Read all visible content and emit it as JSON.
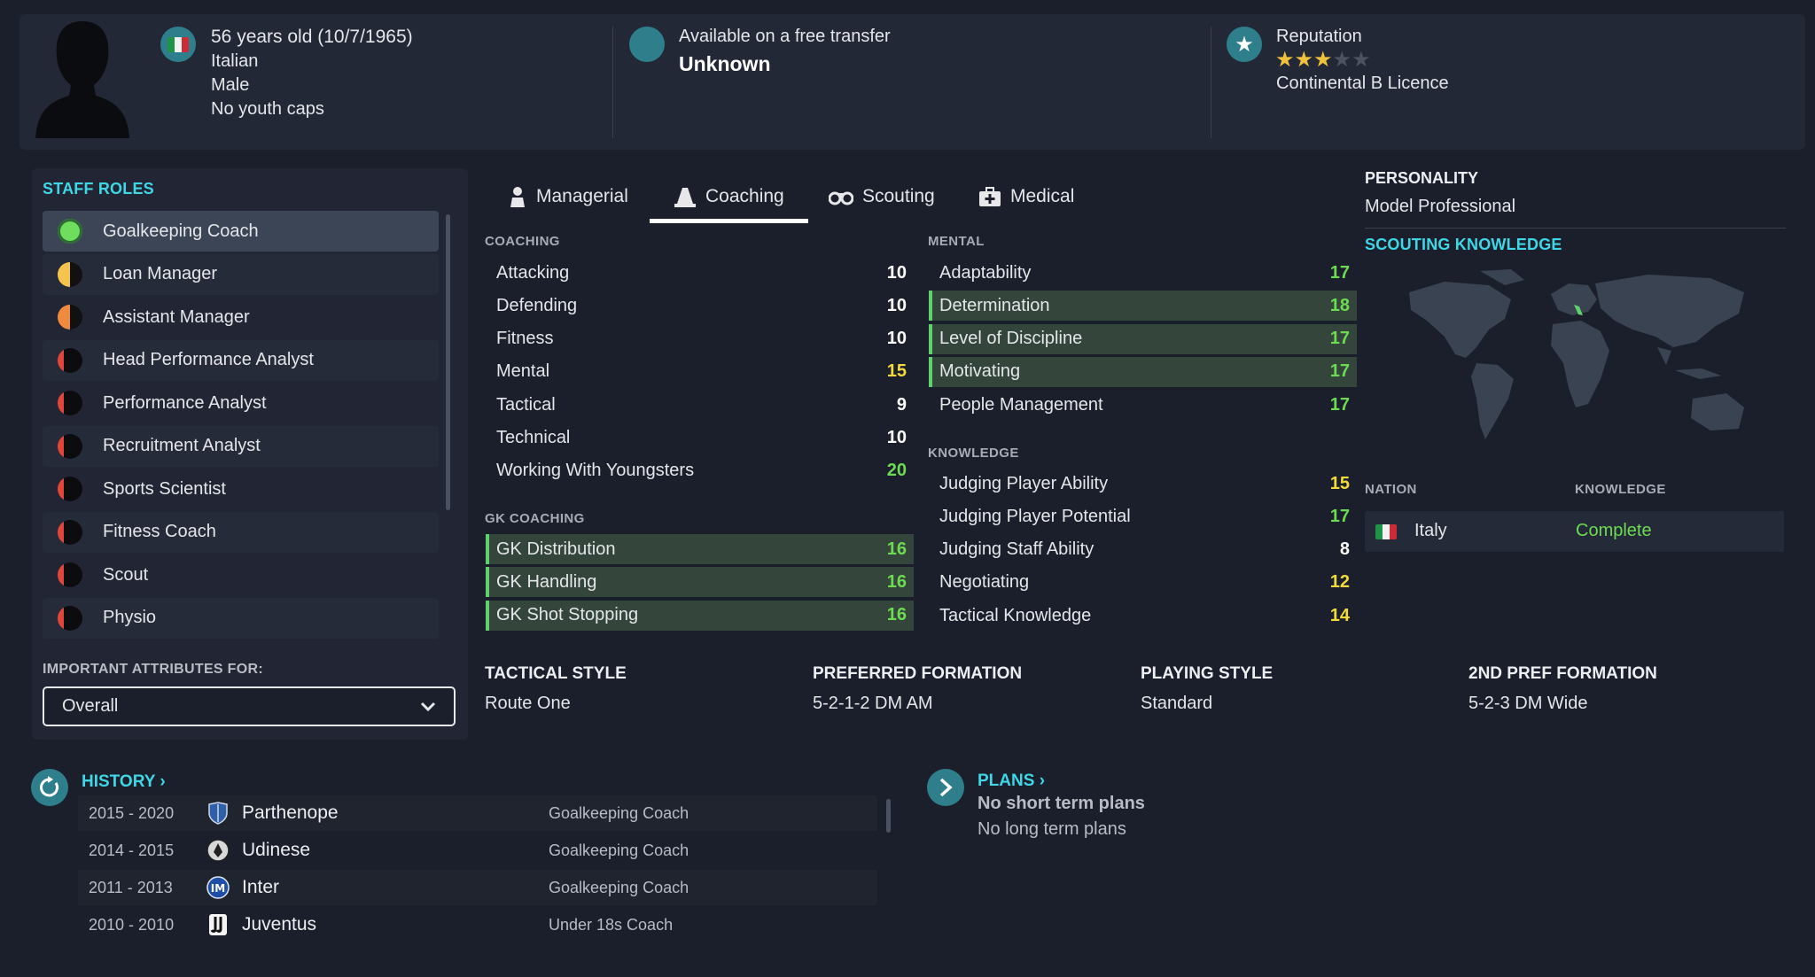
{
  "header": {
    "age_dob": "56 years old (10/7/1965)",
    "nationality": "Italian",
    "gender": "Male",
    "youth_caps": "No youth caps",
    "contract_status": "Available on a free transfer",
    "contract_value": "Unknown",
    "reputation_label": "Reputation",
    "reputation_stars": 3,
    "reputation_max": 5,
    "licence": "Continental B Licence"
  },
  "staff_roles": {
    "title": "STAFF ROLES",
    "items": [
      {
        "label": "Goalkeeping Coach",
        "suitability": "green"
      },
      {
        "label": "Loan Manager",
        "suitability": "half-yellow"
      },
      {
        "label": "Assistant Manager",
        "suitability": "half-orange"
      },
      {
        "label": "Head Performance Analyst",
        "suitability": "red"
      },
      {
        "label": "Performance Analyst",
        "suitability": "red"
      },
      {
        "label": "Recruitment Analyst",
        "suitability": "red"
      },
      {
        "label": "Sports Scientist",
        "suitability": "red"
      },
      {
        "label": "Fitness Coach",
        "suitability": "red"
      },
      {
        "label": "Scout",
        "suitability": "red"
      },
      {
        "label": "Physio",
        "suitability": "red"
      }
    ],
    "important_label": "IMPORTANT ATTRIBUTES FOR:",
    "important_value": "Overall"
  },
  "tabs": [
    {
      "label": "Managerial",
      "icon": "manager-icon"
    },
    {
      "label": "Coaching",
      "icon": "cone-icon",
      "active": true
    },
    {
      "label": "Scouting",
      "icon": "binoculars-icon"
    },
    {
      "label": "Medical",
      "icon": "medical-kit-icon"
    }
  ],
  "coaching": {
    "title": "COACHING",
    "rows": [
      {
        "name": "Attacking",
        "value": "10",
        "color": "white"
      },
      {
        "name": "Defending",
        "value": "10",
        "color": "white"
      },
      {
        "name": "Fitness",
        "value": "10",
        "color": "white"
      },
      {
        "name": "Mental",
        "value": "15",
        "color": "yellow"
      },
      {
        "name": "Tactical",
        "value": "9",
        "color": "white"
      },
      {
        "name": "Technical",
        "value": "10",
        "color": "white"
      },
      {
        "name": "Working With Youngsters",
        "value": "20",
        "color": "green"
      }
    ]
  },
  "gk_coaching": {
    "title": "GK COACHING",
    "rows": [
      {
        "name": "GK Distribution",
        "value": "16",
        "color": "green",
        "highlight": true
      },
      {
        "name": "GK Handling",
        "value": "16",
        "color": "green",
        "highlight": true
      },
      {
        "name": "GK Shot Stopping",
        "value": "16",
        "color": "green",
        "highlight": true
      }
    ]
  },
  "mental": {
    "title": "MENTAL",
    "rows": [
      {
        "name": "Adaptability",
        "value": "17",
        "color": "green"
      },
      {
        "name": "Determination",
        "value": "18",
        "color": "green",
        "highlight": true
      },
      {
        "name": "Level of Discipline",
        "value": "17",
        "color": "green",
        "highlight": true
      },
      {
        "name": "Motivating",
        "value": "17",
        "color": "green",
        "highlight": true
      },
      {
        "name": "People Management",
        "value": "17",
        "color": "green"
      }
    ]
  },
  "knowledge": {
    "title": "KNOWLEDGE",
    "rows": [
      {
        "name": "Judging Player Ability",
        "value": "15",
        "color": "yellow"
      },
      {
        "name": "Judging Player Potential",
        "value": "17",
        "color": "green"
      },
      {
        "name": "Judging Staff Ability",
        "value": "8",
        "color": "white"
      },
      {
        "name": "Negotiating",
        "value": "12",
        "color": "yellow"
      },
      {
        "name": "Tactical Knowledge",
        "value": "14",
        "color": "yellow"
      }
    ]
  },
  "styles": [
    {
      "title": "TACTICAL STYLE",
      "value": "Route One"
    },
    {
      "title": "PREFERRED FORMATION",
      "value": "5-2-1-2 DM AM"
    },
    {
      "title": "PLAYING STYLE",
      "value": "Standard"
    },
    {
      "title": "2ND PREF FORMATION",
      "value": "5-2-3 DM Wide"
    }
  ],
  "personality": {
    "title": "PERSONALITY",
    "value": "Model Professional"
  },
  "scouting_knowledge": {
    "title": "SCOUTING KNOWLEDGE",
    "nation_header": "NATION",
    "knowledge_header": "KNOWLEDGE",
    "nation": "Italy",
    "level": "Complete"
  },
  "history": {
    "title": "HISTORY",
    "rows": [
      {
        "years": "2015 - 2020",
        "club": "Parthenope",
        "role": "Goalkeeping Coach",
        "badge": "shield-badge-icon"
      },
      {
        "years": "2014 - 2015",
        "club": "Udinese",
        "role": "Goalkeeping Coach",
        "badge": "udinese-badge-icon"
      },
      {
        "years": "2011 - 2013",
        "club": "Inter",
        "role": "Goalkeeping Coach",
        "badge": "inter-badge-icon"
      },
      {
        "years": "2010 - 2010",
        "club": "Juventus",
        "role": "Under 18s Coach",
        "badge": "juventus-badge-icon"
      }
    ]
  },
  "plans": {
    "title": "PLANS",
    "short_term": "No short term plans",
    "long_term": "No long term plans"
  },
  "colors": {
    "accent": "#3fd6e6",
    "highlight_bar": "#5ed26d",
    "value_green": "#6ddb52",
    "value_yellow": "#f3da3b",
    "selected_row": "#3c4556"
  }
}
